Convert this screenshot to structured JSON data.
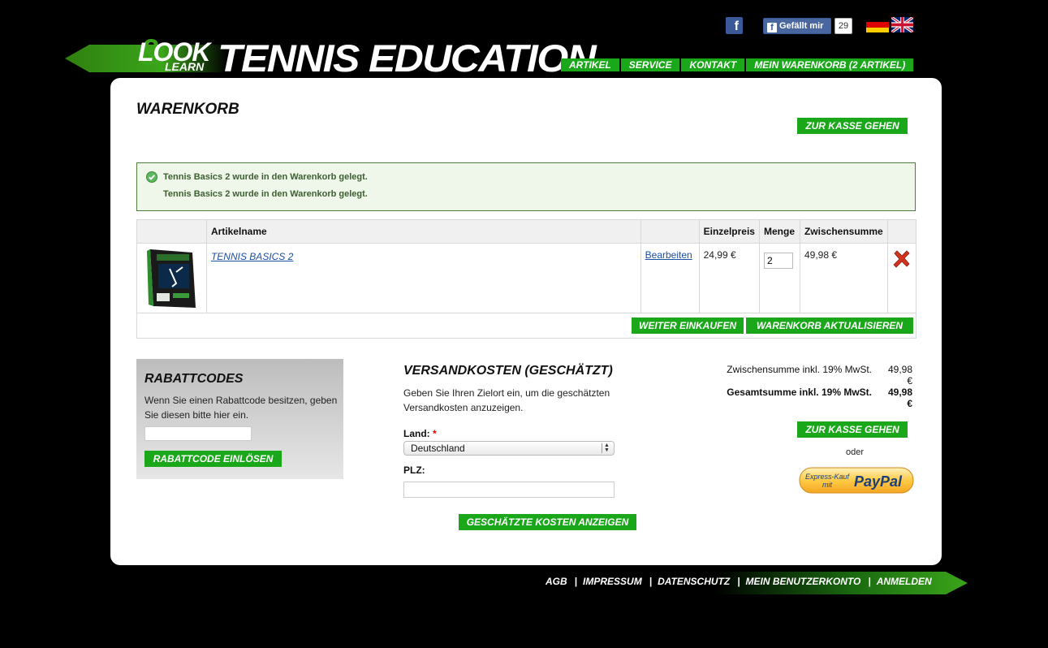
{
  "header": {
    "facebook_like_label": "Gefällt mir",
    "facebook_like_count": "29",
    "logo_word1": "LOOK",
    "logo_word2": "LEARN",
    "site_title": "TENNIS EDUCATION",
    "nav": [
      "ARTIKEL",
      "SERVICE",
      "KONTAKT",
      "MEIN WARENKORB (2 ARTIKEL)"
    ]
  },
  "cart": {
    "title": "WARENKORB",
    "checkout_label": "ZUR KASSE GEHEN",
    "messages": [
      "Tennis Basics 2 wurde in den Warenkorb gelegt.",
      "Tennis Basics 2 wurde in den Warenkorb gelegt."
    ],
    "columns": [
      "",
      "Artikelname",
      "",
      "Einzelpreis",
      "Menge",
      "Zwischensumme",
      ""
    ],
    "items": [
      {
        "name": "TENNIS BASICS 2",
        "edit_label": "Bearbeiten",
        "price": "24,99 €",
        "qty": "2",
        "subtotal": "49,98 €"
      }
    ],
    "continue_label": "WEITER EINKAUFEN",
    "update_label": "WARENKORB AKTUALISIEREN"
  },
  "coupon": {
    "title": "RABATTCODES",
    "text": "Wenn Sie einen Rabattcode besitzen, geben Sie diesen bitte hier ein.",
    "button": "RABATTCODE EINLÖSEN"
  },
  "shipping": {
    "title": "VERSANDKOSTEN (GESCHÄTZT)",
    "text": "Geben Sie Ihren Zielort ein, um die geschätzten Versandkosten anzuzeigen.",
    "country_label": "Land:",
    "required_mark": "*",
    "country_value": "Deutschland",
    "zip_label": "PLZ:",
    "button": "GESCHÄTZTE KOSTEN ANZEIGEN"
  },
  "totals": {
    "subtotal_label": "Zwischensumme inkl. 19% MwSt.",
    "subtotal_value": "49,98 €",
    "grand_label": "Gesamtsumme inkl. 19% MwSt.",
    "grand_value": "49,98 €",
    "checkout_label": "ZUR KASSE GEHEN",
    "or_label": "oder",
    "paypal_text1": "Express-Kauf",
    "paypal_text2": "mit",
    "paypal_brand": "PayPal"
  },
  "footer": {
    "links": [
      "AGB",
      "IMPRESSUM",
      "DATENSCHUTZ",
      "MEIN BENUTZERKONTO",
      "ANMELDEN"
    ],
    "separator": "|"
  },
  "colors": {
    "accent": "#1aa71a",
    "background": "#000000",
    "panel": "#ffffff"
  }
}
